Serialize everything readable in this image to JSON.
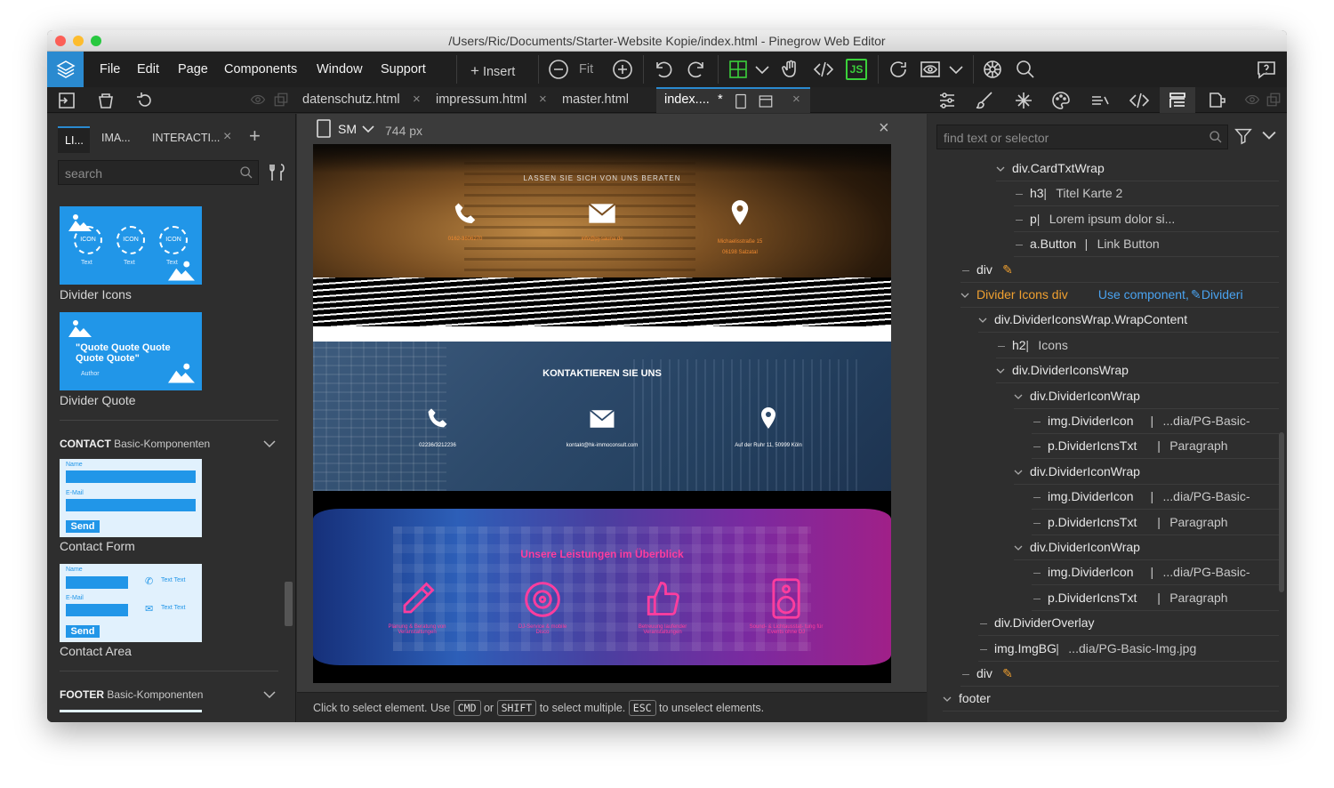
{
  "window": {
    "title": "/Users/Ric/Documents/Starter-Website Kopie/index.html - Pinegrow Web Editor"
  },
  "menu": [
    "File",
    "Edit",
    "Page",
    "Components",
    "Window",
    "Support"
  ],
  "toolbar": {
    "insert": "Insert",
    "fit": "Fit",
    "js": "JS"
  },
  "doc_tabs": [
    {
      "label": "datenschutz.html"
    },
    {
      "label": "impressum.html"
    },
    {
      "label": "master.html"
    },
    {
      "label": "index....",
      "modified": "*"
    }
  ],
  "left": {
    "tabs": [
      "LI...",
      "IMA...",
      "INTERACTI..."
    ],
    "search_placeholder": "search",
    "blocks": [
      {
        "label": "Divider Icons",
        "icon_text": "ICON",
        "sub": "Text"
      },
      {
        "label": "Divider Quote",
        "quote": "\"Quote Quote Quote Quote Quote\"",
        "author": "Author"
      }
    ],
    "contact_section": {
      "title": "CONTACT",
      "subtitle": "Basic-Komponenten"
    },
    "contact_blocks": [
      {
        "label": "Contact Form",
        "name": "Name",
        "email": "E-Mail",
        "send": "Send"
      },
      {
        "label": "Contact Area",
        "name": "Name",
        "email": "E-Mail",
        "send": "Send",
        "text": "Text Text"
      }
    ],
    "footer_section": {
      "title": "FOOTER",
      "subtitle": "Basic-Komponenten"
    }
  },
  "canvas": {
    "device": "SM",
    "width": "744 px",
    "section1": {
      "heading": "LASSEN SIE SICH VON UNS BERATEN",
      "items": [
        "0162-3606270",
        "info@pj-sauna.de",
        "Michaelisstraße 15 06198 Salzatal"
      ]
    },
    "section2": {
      "heading": "KONTAKTIEREN SIE UNS",
      "items": [
        "02236/3212236",
        "kontakt@hk-immoconsult.com",
        "Auf der Ruhr 11, 50999 Köln"
      ]
    },
    "section3": {
      "heading": "Unsere Leistungen im Überblick",
      "items": [
        "Planung & Beratung von Veranstaltungen",
        "DJ-Service & mobile Disco",
        "Betreuung laufender Veranstaltungen",
        "Sound- & Lichtausstat- tung für Events ohne DJ"
      ]
    }
  },
  "status": {
    "a": "Click to select element. Use",
    "cmd": "CMD",
    "b": "or",
    "shift": "SHIFT",
    "c": "to select multiple.",
    "esc": "ESC",
    "d": "to unselect elements."
  },
  "right": {
    "search_placeholder": "find text or selector",
    "tree": [
      {
        "indent": 1,
        "t": "div.CardTxtWrap",
        "chev": true
      },
      {
        "indent": 2,
        "t": "h3",
        "d": "Titel Karte 2"
      },
      {
        "indent": 2,
        "t": "p",
        "d": "Lorem ipsum dolor si..."
      },
      {
        "indent": 2,
        "t": "a.Button",
        "d": "Link Button"
      },
      {
        "indent": -1,
        "t": "div",
        "pen": true
      },
      {
        "indent": -1,
        "t": "Divider Icons div",
        "chev": true,
        "comp": true,
        "link": "Use component,",
        "link2": "Divideri"
      },
      {
        "indent": 0,
        "t": "div.DividerIconsWrap.WrapContent",
        "chev": true
      },
      {
        "indent": 1,
        "t": "h2",
        "d": "Icons"
      },
      {
        "indent": 1,
        "t": "div.DividerIconsWrap",
        "chev": true
      },
      {
        "indent": 2,
        "t": "div.DividerIconWrap",
        "chev": true
      },
      {
        "indent": 3,
        "t": "img.DividerIcon",
        "d": "...dia/PG-Basic-"
      },
      {
        "indent": 3,
        "t": "p.DividerIcnsTxt",
        "d": "Paragraph"
      },
      {
        "indent": 2,
        "t": "div.DividerIconWrap",
        "chev": true
      },
      {
        "indent": 3,
        "t": "img.DividerIcon",
        "d": "...dia/PG-Basic-"
      },
      {
        "indent": 3,
        "t": "p.DividerIcnsTxt",
        "d": "Paragraph"
      },
      {
        "indent": 2,
        "t": "div.DividerIconWrap",
        "chev": true
      },
      {
        "indent": 3,
        "t": "img.DividerIcon",
        "d": "...dia/PG-Basic-"
      },
      {
        "indent": 3,
        "t": "p.DividerIcnsTxt",
        "d": "Paragraph"
      },
      {
        "indent": 0,
        "t": "div.DividerOverlay"
      },
      {
        "indent": 0,
        "t": "img.ImgBG",
        "d": "...dia/PG-Basic-Img.jpg"
      },
      {
        "indent": -1,
        "t": "div",
        "pen": true
      },
      {
        "indent": -2,
        "t": "footer",
        "chev": true
      }
    ]
  },
  "colors": {
    "accent": "#2a8ad0",
    "pink": "#ff3d9e",
    "orange": "#f0a030",
    "link": "#4aa3f0"
  }
}
